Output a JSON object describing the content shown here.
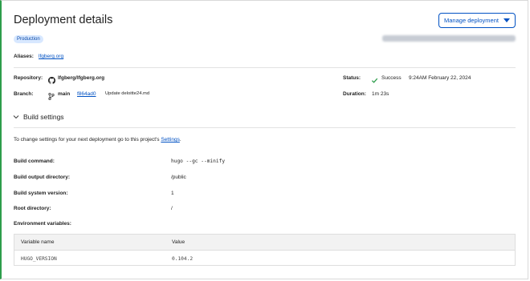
{
  "header": {
    "title": "Deployment details",
    "manage_label": "Manage deployment"
  },
  "environment_badge": "Production",
  "aliases": {
    "label": "Aliases:",
    "value": "lfgberg.org"
  },
  "repository": {
    "label": "Repository:",
    "value": "lfgberg/lfgberg.org"
  },
  "branch": {
    "label": "Branch:",
    "name": "main",
    "commit": "f864ad0",
    "message": "Update deloitte24.md"
  },
  "status": {
    "label": "Status:",
    "value": "Success",
    "time": "9:24AM February 22, 2024"
  },
  "duration": {
    "label": "Duration:",
    "value": "1m 23s"
  },
  "build_settings": {
    "title": "Build settings",
    "note_prefix": "To change settings for your next deployment go to this project's ",
    "note_link": "Settings",
    "note_suffix": ".",
    "rows": [
      {
        "label": "Build command:",
        "value": "hugo --gc --minify"
      },
      {
        "label": "Build output directory:",
        "value": "/public"
      },
      {
        "label": "Build system version:",
        "value": "1"
      },
      {
        "label": "Root directory:",
        "value": "/"
      }
    ],
    "env_label": "Environment variables:",
    "env_table": {
      "columns": [
        "Variable name",
        "Value"
      ],
      "rows": [
        {
          "name": "HUGO_VERSION",
          "value": "0.104.2"
        }
      ]
    }
  },
  "colors": {
    "accent": "#0051c3",
    "success": "#2d9d4b",
    "badge_bg": "#d8e8ff"
  }
}
